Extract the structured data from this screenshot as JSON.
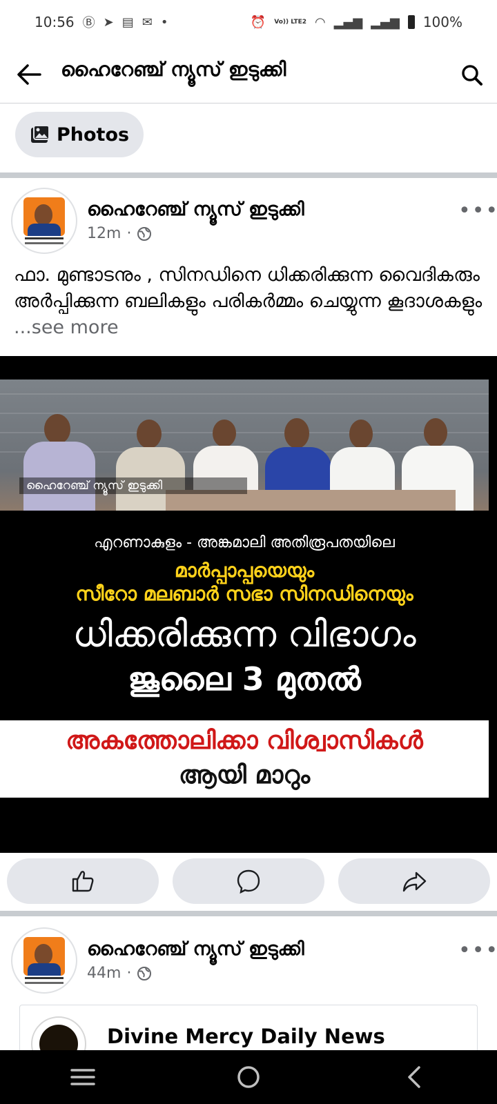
{
  "status_bar": {
    "time": "10:56",
    "battery": "100%",
    "network_label": "Vo)) LTE2",
    "left_icons": [
      "b-circle-icon",
      "telegram-icon",
      "news-icon",
      "gmail-icon",
      "dot-icon"
    ],
    "right_icons": [
      "alarm-icon",
      "wifi-icon",
      "signal-icon",
      "signal-icon",
      "battery-icon"
    ]
  },
  "app_bar": {
    "title": "ഹൈറേഞ്ച് ന്യൂസ് ഇടുക്കി"
  },
  "filter_chip": {
    "label": "Photos"
  },
  "post1": {
    "author": "ഹൈറേഞ്ച് ന്യൂസ് ഇടുക്കി",
    "time": "12m",
    "separator": "·",
    "text": "ഫാ. മുണ്ടാടനും , സിനഡിനെ ധിക്കരിക്കുന്ന വൈദികരും അർപ്പിക്കുന്ന ബലികളും പരികർമ്മം ചെയ്യുന്ന കൂദാശകളും ",
    "see_more": "...see more",
    "image": {
      "watermark": "ഹൈറേഞ്ച് ന്യൂസ് ഇടുക്കി",
      "line1": "എറണാകുളം - അങ്കമാലി അതിരൂപതയിലെ",
      "line2": "മാർപ്പാപ്പയെയും",
      "line3": "സീറോ മലബാർ സഭാ സിനഡിനെയും",
      "line4": "ധിക്കരിക്കുന്ന വിഭാഗം",
      "line5": "ജൂലൈ 3 മുതൽ",
      "line6": "അകത്തോലിക്കാ വിശ്വാസികൾ",
      "line7": "ആയി മാറും"
    }
  },
  "post2": {
    "author": "ഹൈറേഞ്ച് ന്യൂസ് ഇടുക്കി",
    "time": "44m",
    "separator": "·",
    "shared_title": "Divine Mercy Daily News"
  },
  "colors": {
    "chip_bg": "#e4e6eb",
    "secondary_text": "#65676b",
    "image_yellow": "#ffd21a",
    "image_red": "#d01818"
  }
}
